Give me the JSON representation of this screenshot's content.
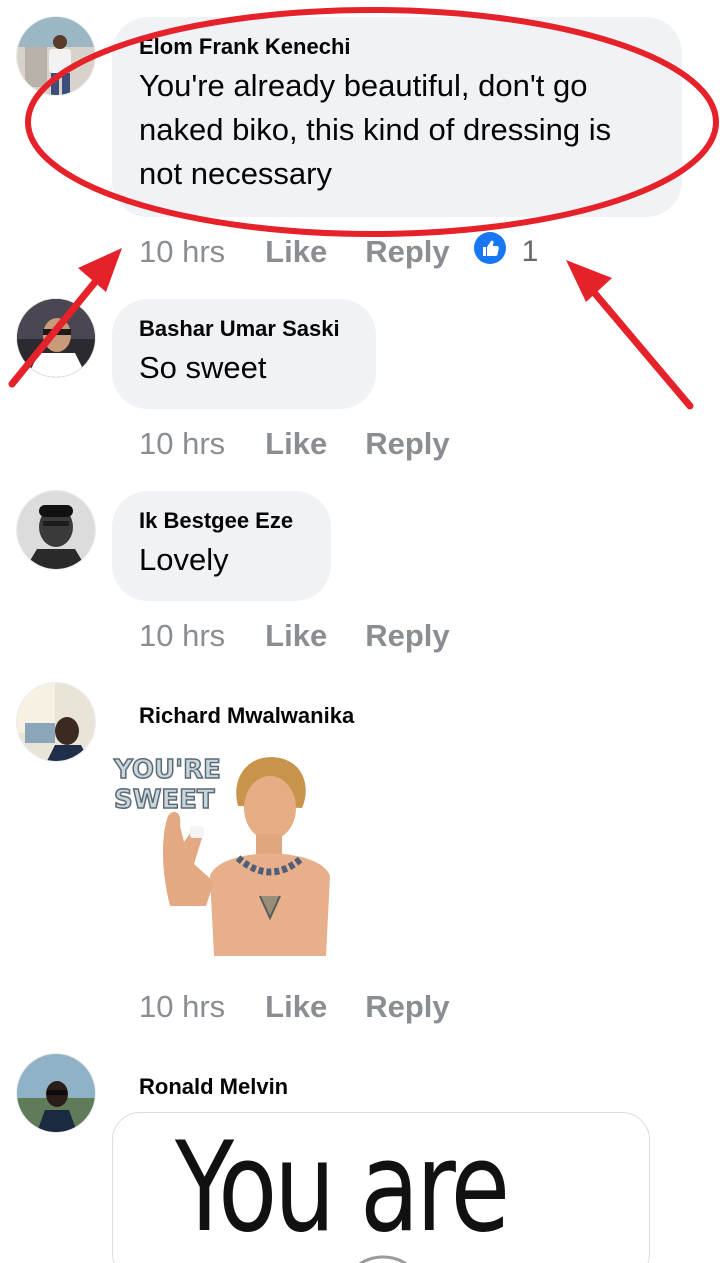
{
  "comments": [
    {
      "author": "Elom Frank Kenechi",
      "text": "You're already beautiful, don't go naked biko, this kind of dressing is not necessary",
      "time": "10 hrs",
      "like_label": "Like",
      "reply_label": "Reply",
      "reaction_count": "1"
    },
    {
      "author": "Bashar Umar Saski",
      "text": "So sweet",
      "time": "10 hrs",
      "like_label": "Like",
      "reply_label": "Reply"
    },
    {
      "author": "Ik Bestgee Eze",
      "text": "Lovely",
      "time": "10 hrs",
      "like_label": "Like",
      "reply_label": "Reply"
    },
    {
      "author": "Richard Mwalwanika",
      "sticker_text": "YOU'RE SWEET",
      "time": "10 hrs",
      "like_label": "Like",
      "reply_label": "Reply"
    },
    {
      "author": "Ronald Melvin",
      "image_text": "You are"
    }
  ],
  "colors": {
    "bubble": "#f0f2f5",
    "meta_text": "#8a8d91",
    "like_blue": "#1877f2",
    "annotation_red": "#e5222a"
  },
  "icons": {
    "reaction": "thumbs-up-icon"
  }
}
